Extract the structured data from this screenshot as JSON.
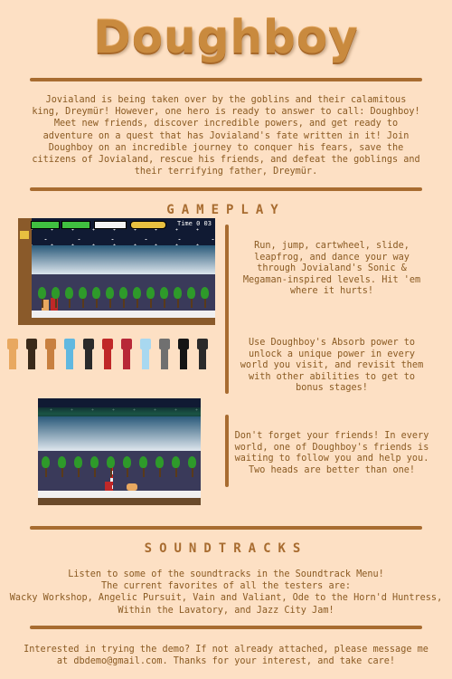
{
  "title": "Doughboy",
  "intro": "Jovialand is being taken over by the goblins and their calamitous king, Dreymür! However, one hero is ready to answer to call: Doughboy! Meet new friends, discover incredible powers, and get ready to adventure on a quest that has Jovialand's fate written in it! Join Doughboy on an incredible journey to conquer his fears, save the citizens of Jovialand, rescue his friends, and defeat the goblings and their terrifying father, Dreymür.",
  "gameplay": {
    "heading": "GAMEPLAY",
    "hud_time": "Time 0 03",
    "features": [
      "Run, jump, cartwheel, slide, leapfrog, and dance your way through Jovialand's Sonic & Megaman-inspired levels. Hit 'em where it hurts!",
      "Use Doughboy's Absorb power to unlock a unique power in every world you visit, and revisit them with other abilities to get to bonus stages!",
      "Don't forget your friends! In every world, one of Doughboy's friends is waiting to follow you and help you. Two heads are better than one!"
    ]
  },
  "soundtracks": {
    "heading": "SOUNDTRACKS",
    "lines": [
      "Listen to some of the soundtracks in the Soundtrack Menu!",
      "The current favorites of all the testers are:",
      "Wacky Workshop, Angelic Pursuit, Vain and Valiant, Ode to the Horn'd Huntress,",
      "Within the Lavatory, and Jazz City Jam!"
    ]
  },
  "footer": {
    "lines": [
      "Interested in trying the demo? If not already attached, please message me",
      "at dbdemo@gmail.com. Thanks for your interest, and take care!"
    ]
  },
  "colors": {
    "background": "#fde0c4",
    "accent": "#a86c30",
    "text": "#8a5a22"
  },
  "sprites": [
    "#e8a860",
    "#3a2a1a",
    "#c88040",
    "#60b8e0",
    "#2a2a2a",
    "#c02828",
    "#b82838",
    "#a8d8f0",
    "#707070",
    "#151515",
    "#2a2a2a"
  ]
}
